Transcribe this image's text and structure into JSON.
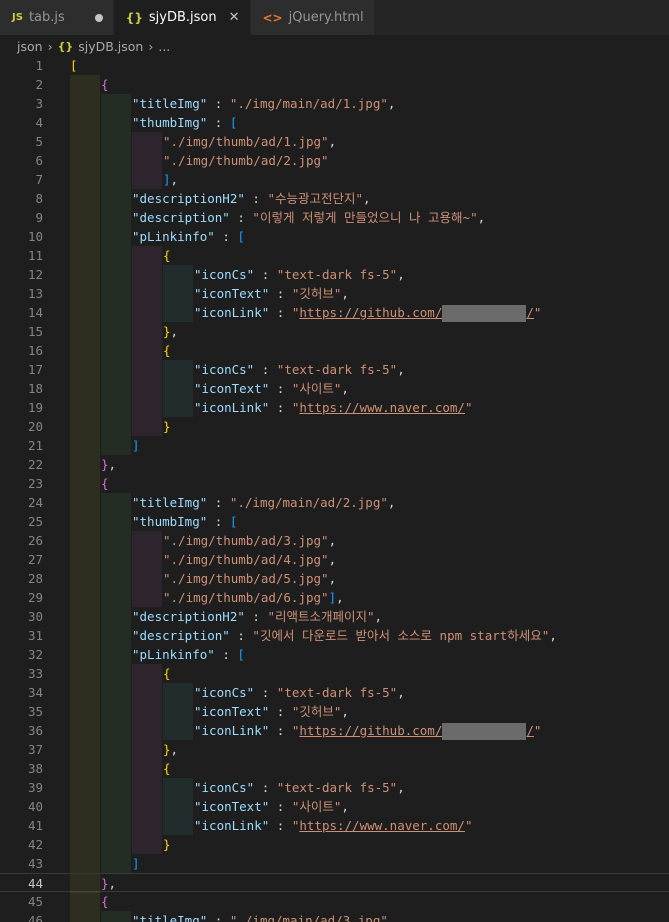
{
  "tabs": [
    {
      "icon": "JS",
      "label": "tab.js",
      "state": "modified"
    },
    {
      "icon": "{}",
      "label": "sjyDB.json",
      "state": "active"
    },
    {
      "icon": "<>",
      "label": "jQuery.html",
      "state": "normal"
    }
  ],
  "tab_close_glyph": "✕",
  "breadcrumb": {
    "folder": "json",
    "file": "sjyDB.json",
    "more": "..."
  },
  "editor": {
    "language": "json",
    "current_line": 44,
    "lines": [
      {
        "n": "1",
        "text": "["
      },
      {
        "n": "2",
        "text": "    {"
      },
      {
        "n": "3",
        "text": "        \"titleImg\" : \"./img/main/ad/1.jpg\","
      },
      {
        "n": "4",
        "text": "        \"thumbImg\" : ["
      },
      {
        "n": "5",
        "text": "            \"./img/thumb/ad/1.jpg\","
      },
      {
        "n": "6",
        "text": "            \"./img/thumb/ad/2.jpg\""
      },
      {
        "n": "7",
        "text": "            ],"
      },
      {
        "n": "8",
        "text": "        \"descriptionH2\" : \"수능광고전단지\","
      },
      {
        "n": "9",
        "text": "        \"description\" : \"이렇게 저렇게 만들었으니 나 고용해~\","
      },
      {
        "n": "10",
        "text": "        \"pLinkinfo\" : ["
      },
      {
        "n": "11",
        "text": "            {"
      },
      {
        "n": "12",
        "text": "                \"iconCs\" : \"text-dark fs-5\","
      },
      {
        "n": "13",
        "text": "                \"iconText\" : \"깃허브\","
      },
      {
        "n": "14",
        "text": "                \"iconLink\" : \"https://github.com/[redacted]/\""
      },
      {
        "n": "15",
        "text": "            },"
      },
      {
        "n": "16",
        "text": "            {"
      },
      {
        "n": "17",
        "text": "                \"iconCs\" : \"text-dark fs-5\","
      },
      {
        "n": "18",
        "text": "                \"iconText\" : \"사이트\","
      },
      {
        "n": "19",
        "text": "                \"iconLink\" : \"https://www.naver.com/\""
      },
      {
        "n": "20",
        "text": "            }"
      },
      {
        "n": "21",
        "text": "        ]"
      },
      {
        "n": "22",
        "text": "    },"
      },
      {
        "n": "23",
        "text": "    {"
      },
      {
        "n": "24",
        "text": "        \"titleImg\" : \"./img/main/ad/2.jpg\","
      },
      {
        "n": "25",
        "text": "        \"thumbImg\" : ["
      },
      {
        "n": "26",
        "text": "            \"./img/thumb/ad/3.jpg\","
      },
      {
        "n": "27",
        "text": "            \"./img/thumb/ad/4.jpg\","
      },
      {
        "n": "28",
        "text": "            \"./img/thumb/ad/5.jpg\","
      },
      {
        "n": "29",
        "text": "            \"./img/thumb/ad/6.jpg\"],"
      },
      {
        "n": "30",
        "text": "        \"descriptionH2\" : \"리액트소개페이지\","
      },
      {
        "n": "31",
        "text": "        \"description\" : \"깃에서 다운로드 받아서 소스로 npm start하세요\","
      },
      {
        "n": "32",
        "text": "        \"pLinkinfo\" : ["
      },
      {
        "n": "33",
        "text": "            {"
      },
      {
        "n": "34",
        "text": "                \"iconCs\" : \"text-dark fs-5\","
      },
      {
        "n": "35",
        "text": "                \"iconText\" : \"깃허브\","
      },
      {
        "n": "36",
        "text": "                \"iconLink\" : \"https://github.com/[redacted]/\""
      },
      {
        "n": "37",
        "text": "            },"
      },
      {
        "n": "38",
        "text": "            {"
      },
      {
        "n": "39",
        "text": "                \"iconCs\" : \"text-dark fs-5\","
      },
      {
        "n": "40",
        "text": "                \"iconText\" : \"사이트\","
      },
      {
        "n": "41",
        "text": "                \"iconLink\" : \"https://www.naver.com/\""
      },
      {
        "n": "42",
        "text": "            }"
      },
      {
        "n": "43",
        "text": "        ]"
      },
      {
        "n": "44",
        "text": "    },"
      },
      {
        "n": "45",
        "text": "    {"
      },
      {
        "n": "46",
        "text": "        \"titleImg\" : \"./img/main/ad/3.jpg\","
      }
    ]
  },
  "colors": {
    "background": "#1e1e1e",
    "key": "#9cdcfe",
    "string": "#ce9178",
    "bracket_level1": "#ffd700",
    "bracket_level2": "#da70d6",
    "bracket_level3": "#179fff"
  }
}
